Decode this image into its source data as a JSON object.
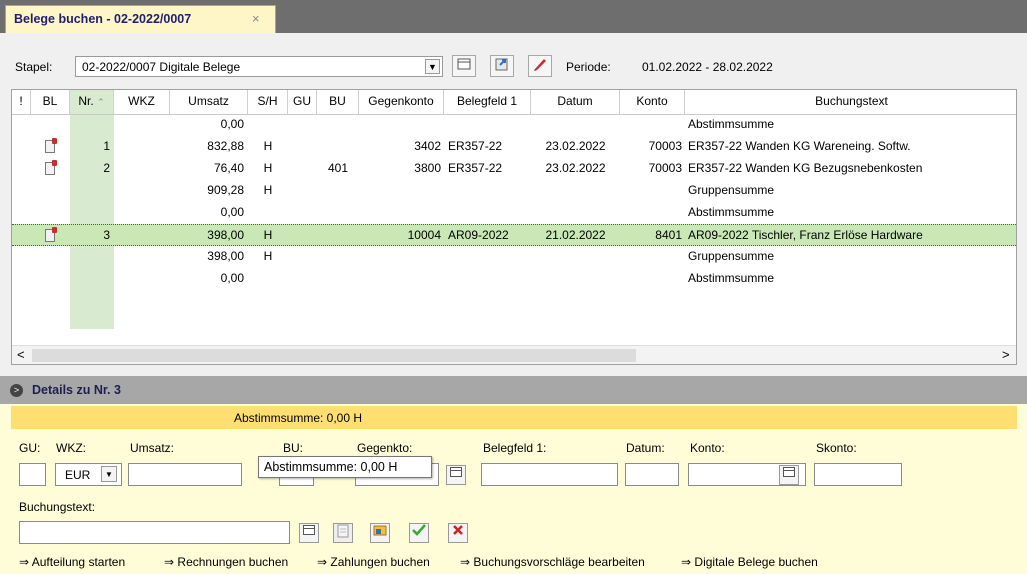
{
  "tab": {
    "title": "Belege buchen  - 02-2022/0007",
    "close": "×"
  },
  "stapel": {
    "label": "Stapel:",
    "value": "02-2022/0007  Digitale Belege",
    "periode_label": "Periode:",
    "periode_value": "01.02.2022 - 28.02.2022"
  },
  "grid": {
    "headers": [
      "!",
      "BL",
      "Nr.",
      "WKZ",
      "Umsatz",
      "S/H",
      "GU",
      "BU",
      "Gegenkonto",
      "Belegfeld 1",
      "Datum",
      "Konto",
      "Buchungstext"
    ],
    "sort_glyph": "⌃",
    "rows": [
      {
        "nr": "",
        "umsatz": "0,00",
        "sh": "",
        "bu": "",
        "gegenkonto": "",
        "belegfeld": "",
        "datum": "",
        "konto": "",
        "text": "Abstimmsumme",
        "icon": false,
        "selected": false
      },
      {
        "nr": "1",
        "umsatz": "832,88",
        "sh": "H",
        "bu": "",
        "gegenkonto": "3402",
        "belegfeld": "ER357-22",
        "datum": "23.02.2022",
        "konto": "70003",
        "text": "ER357-22 Wanden KG Wareneing. Softw.",
        "icon": true,
        "selected": false
      },
      {
        "nr": "2",
        "umsatz": "76,40",
        "sh": "H",
        "bu": "401",
        "gegenkonto": "3800",
        "belegfeld": "ER357-22",
        "datum": "23.02.2022",
        "konto": "70003",
        "text": "ER357-22 Wanden KG Bezugsnebenkosten",
        "icon": true,
        "selected": false
      },
      {
        "nr": "",
        "umsatz": "909,28",
        "sh": "H",
        "bu": "",
        "gegenkonto": "",
        "belegfeld": "",
        "datum": "",
        "konto": "",
        "text": "Gruppensumme",
        "icon": false,
        "selected": false
      },
      {
        "nr": "",
        "umsatz": "0,00",
        "sh": "",
        "bu": "",
        "gegenkonto": "",
        "belegfeld": "",
        "datum": "",
        "konto": "",
        "text": "Abstimmsumme",
        "icon": false,
        "selected": false
      },
      {
        "nr": "3",
        "umsatz": "398,00",
        "sh": "H",
        "bu": "",
        "gegenkonto": "10004",
        "belegfeld": "AR09-2022",
        "datum": "21.02.2022",
        "konto": "8401",
        "text": "AR09-2022 Tischler, Franz Erlöse Hardware",
        "icon": true,
        "selected": true
      },
      {
        "nr": "",
        "umsatz": "398,00",
        "sh": "H",
        "bu": "",
        "gegenkonto": "",
        "belegfeld": "",
        "datum": "",
        "konto": "",
        "text": "Gruppensumme",
        "icon": false,
        "selected": false
      },
      {
        "nr": "",
        "umsatz": "0,00",
        "sh": "",
        "bu": "",
        "gegenkonto": "",
        "belegfeld": "",
        "datum": "",
        "konto": "",
        "text": "Abstimmsumme",
        "icon": false,
        "selected": false
      }
    ],
    "scroll_left": "<",
    "scroll_right": ">"
  },
  "details": {
    "title": "Details zu Nr. 3",
    "expand_glyph": ">",
    "abstimm": "Abstimmsumme: 0,00 H",
    "labels": {
      "gu": "GU:",
      "wkz": "WKZ:",
      "umsatz": "Umsatz:",
      "bu": "BU:",
      "gegenkto": "Gegenkto:",
      "belegfeld": "Belegfeld 1:",
      "datum": "Datum:",
      "konto": "Konto:",
      "skonto": "Skonto:",
      "buchungstext": "Buchungstext:"
    },
    "wkz_value": "EUR",
    "tooltip": "Abstimmsumme: 0,00 H"
  },
  "links": [
    {
      "arrow": "⇒",
      "label": "Aufteilung starten"
    },
    {
      "arrow": "⇒",
      "label": "Rechnungen buchen"
    },
    {
      "arrow": "⇒",
      "label": "Zahlungen buchen"
    },
    {
      "arrow": "⇒",
      "label": "Buchungsvorschläge bearbeiten"
    },
    {
      "arrow": "⇒",
      "label": "Digitale Belege buchen"
    }
  ],
  "colors": {
    "accept": "#3aa832",
    "reject": "#d02020",
    "selection": "#c9e8b6"
  }
}
